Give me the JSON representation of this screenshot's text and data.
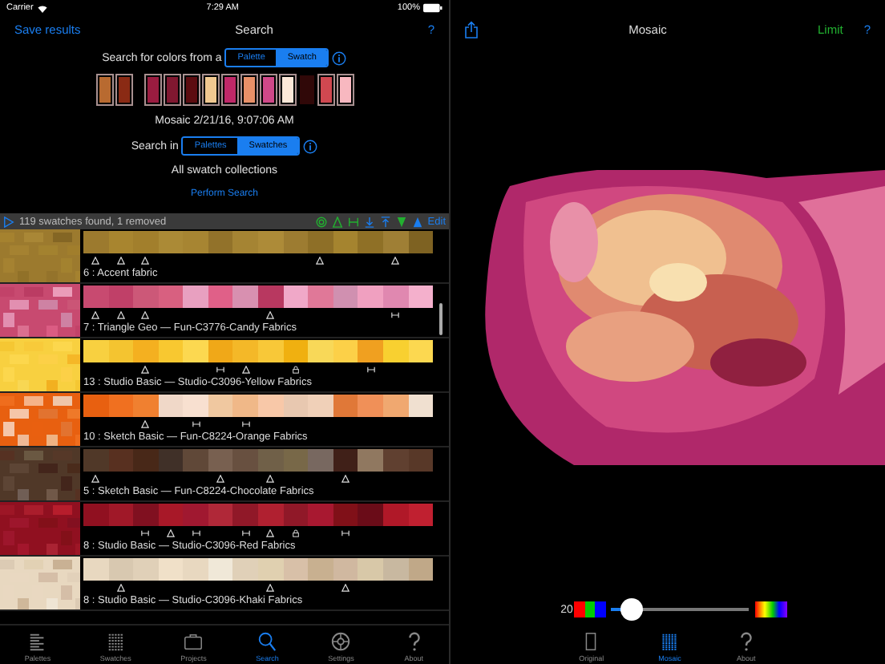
{
  "status_bar": {
    "carrier": "Carrier",
    "time": "7:29 AM",
    "battery": "100%"
  },
  "search_panel": {
    "back": "Save results",
    "title": "Search",
    "help": "?",
    "source_label": "Search for colors from a",
    "source_options": [
      {
        "label": "Palette",
        "selected": false
      },
      {
        "label": "Swatch",
        "selected": true
      }
    ],
    "swatch_groups": [
      {
        "swatches": [
          {
            "color": "#b86a30",
            "outlined": true
          },
          {
            "color": "#8a2a14",
            "outlined": true
          }
        ]
      },
      {
        "swatches": [
          {
            "color": "#9a1c40",
            "outlined": true
          },
          {
            "color": "#801830",
            "outlined": true
          },
          {
            "color": "#5c0c10",
            "outlined": true
          },
          {
            "color": "#f0c890",
            "outlined": true
          },
          {
            "color": "#c02868",
            "outlined": true
          },
          {
            "color": "#e89068",
            "outlined": true
          },
          {
            "color": "#d04888",
            "outlined": true
          },
          {
            "color": "#fde8d8",
            "outlined": true
          },
          {
            "color": "#300808",
            "outlined": false
          },
          {
            "color": "#d04850",
            "outlined": true
          },
          {
            "color": "#f8b8c0",
            "outlined": true
          }
        ]
      }
    ],
    "source_name": "Mosaic 2/21/16, 9:07:06 AM",
    "scope_label": "Search in",
    "scope_options": [
      {
        "label": "Palettes",
        "selected": false
      },
      {
        "label": "Swatches",
        "selected": true
      }
    ],
    "collection": "All swatch collections",
    "action": "Perform Search"
  },
  "results": {
    "summary": "119 swatches found, 1 removed",
    "edit": "Edit",
    "rows": [
      {
        "label": "6 : Accent fabric",
        "cells": [
          {
            "color": "#9c7a2e",
            "kind": "triangle"
          },
          {
            "color": "#a8852f",
            "kind": "triangle"
          },
          {
            "color": "#a27f2c",
            "kind": "triangle"
          },
          {
            "color": "#ab8a36",
            "kind": "plain"
          },
          {
            "color": "#a78532",
            "kind": "plain"
          },
          {
            "color": "#92722a",
            "kind": "plain"
          },
          {
            "color": "#a58433",
            "kind": "plain"
          },
          {
            "color": "#ad8b38",
            "kind": "plain"
          },
          {
            "color": "#9d7c31",
            "kind": "plain"
          },
          {
            "color": "#8e6f27",
            "kind": "triangle"
          },
          {
            "color": "#a5842f",
            "kind": "plain"
          },
          {
            "color": "#8f7026",
            "kind": "plain"
          },
          {
            "color": "#9f7f35",
            "kind": "triangle"
          },
          {
            "color": "#7e6222",
            "kind": "plain"
          }
        ]
      },
      {
        "label": "7 : Triangle Geo — Fun-C3776-Candy Fabrics",
        "cells": [
          {
            "color": "#c84a70",
            "kind": "triangle"
          },
          {
            "color": "#c04068",
            "kind": "triangle"
          },
          {
            "color": "#cc5878",
            "kind": "triangle"
          },
          {
            "color": "#d86080",
            "kind": "plain"
          },
          {
            "color": "#e8a0c0",
            "kind": "plain"
          },
          {
            "color": "#e06088",
            "kind": "plain"
          },
          {
            "color": "#d890b0",
            "kind": "plain"
          },
          {
            "color": "#b83860",
            "kind": "triangle"
          },
          {
            "color": "#f0a8c8",
            "kind": "plain"
          },
          {
            "color": "#e07898",
            "kind": "plain"
          },
          {
            "color": "#d090b0",
            "kind": "plain"
          },
          {
            "color": "#f0a0c0",
            "kind": "plain"
          },
          {
            "color": "#e088b0",
            "kind": "bar"
          },
          {
            "color": "#f4b0cc",
            "kind": "plain"
          }
        ]
      },
      {
        "label": "13 : Studio Basic — Studio-C3096-Yellow Fabrics",
        "cells": [
          {
            "color": "#f8d040",
            "kind": "plain"
          },
          {
            "color": "#f4c430",
            "kind": "plain"
          },
          {
            "color": "#f4b020",
            "kind": "triangle"
          },
          {
            "color": "#f8c830",
            "kind": "plain"
          },
          {
            "color": "#fcd850",
            "kind": "plain"
          },
          {
            "color": "#f0a818",
            "kind": "bar"
          },
          {
            "color": "#f4b828",
            "kind": "triangle"
          },
          {
            "color": "#f8c838",
            "kind": "plain"
          },
          {
            "color": "#f0b010",
            "kind": "lock"
          },
          {
            "color": "#f8d858",
            "kind": "plain"
          },
          {
            "color": "#fcd048",
            "kind": "plain"
          },
          {
            "color": "#f0a020",
            "kind": "bar"
          },
          {
            "color": "#f8d030",
            "kind": "plain"
          },
          {
            "color": "#fcd850",
            "kind": "plain"
          }
        ]
      },
      {
        "label": "10 : Sketch Basic — Fun-C8224-Orange Fabrics",
        "cells": [
          {
            "color": "#e86010",
            "kind": "plain"
          },
          {
            "color": "#f07020",
            "kind": "plain"
          },
          {
            "color": "#f08030",
            "kind": "triangle"
          },
          {
            "color": "#f0d8c8",
            "kind": "plain"
          },
          {
            "color": "#f8e0d0",
            "kind": "bar"
          },
          {
            "color": "#f0c8a0",
            "kind": "plain"
          },
          {
            "color": "#f0b888",
            "kind": "bar"
          },
          {
            "color": "#f8c8a8",
            "kind": "plain"
          },
          {
            "color": "#e8c8b0",
            "kind": "plain"
          },
          {
            "color": "#f0d0b8",
            "kind": "plain"
          },
          {
            "color": "#e07838",
            "kind": "plain"
          },
          {
            "color": "#f09058",
            "kind": "plain"
          },
          {
            "color": "#f0a870",
            "kind": "plain"
          },
          {
            "color": "#f0e0d0",
            "kind": "plain"
          }
        ]
      },
      {
        "label": "5 : Sketch Basic — Fun-C8224-Chocolate Fabrics",
        "cells": [
          {
            "color": "#503828",
            "kind": "triangle"
          },
          {
            "color": "#583020",
            "kind": "plain"
          },
          {
            "color": "#482818",
            "kind": "plain"
          },
          {
            "color": "#403028",
            "kind": "plain"
          },
          {
            "color": "#604838",
            "kind": "plain"
          },
          {
            "color": "#786050",
            "kind": "triangle"
          },
          {
            "color": "#685040",
            "kind": "plain"
          },
          {
            "color": "#706048",
            "kind": "triangle"
          },
          {
            "color": "#786848",
            "kind": "plain"
          },
          {
            "color": "#786860",
            "kind": "plain"
          },
          {
            "color": "#402018",
            "kind": "triangle"
          },
          {
            "color": "#907860",
            "kind": "plain"
          },
          {
            "color": "#604030",
            "kind": "plain"
          },
          {
            "color": "#583828",
            "kind": "plain"
          }
        ]
      },
      {
        "label": "8 : Studio Basic — Studio-C3096-Red Fabrics",
        "cells": [
          {
            "color": "#901020",
            "kind": "plain"
          },
          {
            "color": "#a01828",
            "kind": "plain"
          },
          {
            "color": "#801020",
            "kind": "bar"
          },
          {
            "color": "#a81828",
            "kind": "triangle"
          },
          {
            "color": "#a01830",
            "kind": "bar"
          },
          {
            "color": "#b02838",
            "kind": "plain"
          },
          {
            "color": "#901828",
            "kind": "bar"
          },
          {
            "color": "#b02030",
            "kind": "triangle"
          },
          {
            "color": "#901828",
            "kind": "lock"
          },
          {
            "color": "#a81830",
            "kind": "plain"
          },
          {
            "color": "#801018",
            "kind": "bar"
          },
          {
            "color": "#6a0c18",
            "kind": "plain"
          },
          {
            "color": "#b01828",
            "kind": "plain"
          },
          {
            "color": "#c02030",
            "kind": "plain"
          }
        ]
      },
      {
        "label": "8 : Studio Basic — Studio-C3096-Khaki Fabrics",
        "cells": [
          {
            "color": "#e8d8c0",
            "kind": "plain"
          },
          {
            "color": "#d8c8b0",
            "kind": "triangle"
          },
          {
            "color": "#e0d0b8",
            "kind": "plain"
          },
          {
            "color": "#f0e0c8",
            "kind": "plain"
          },
          {
            "color": "#e8d8c0",
            "kind": "plain"
          },
          {
            "color": "#f0e8d8",
            "kind": "plain"
          },
          {
            "color": "#e0d0b8",
            "kind": "plain"
          },
          {
            "color": "#e0d0b0",
            "kind": "triangle"
          },
          {
            "color": "#d8c0a8",
            "kind": "plain"
          },
          {
            "color": "#c8b090",
            "kind": "plain"
          },
          {
            "color": "#d0b8a0",
            "kind": "triangle"
          },
          {
            "color": "#d8c8a8",
            "kind": "plain"
          },
          {
            "color": "#c8b8a0",
            "kind": "plain"
          },
          {
            "color": "#c0a888",
            "kind": "plain"
          }
        ]
      }
    ]
  },
  "left_tabs": [
    {
      "label": "Palettes",
      "selected": false
    },
    {
      "label": "Swatches",
      "selected": false
    },
    {
      "label": "Projects",
      "selected": false
    },
    {
      "label": "Search",
      "selected": true
    },
    {
      "label": "Settings",
      "selected": false
    },
    {
      "label": "About",
      "selected": false
    }
  ],
  "mosaic_panel": {
    "title": "Mosaic",
    "limit": "Limit",
    "help": "?",
    "slider": {
      "reading": "20",
      "level": 0.15
    }
  },
  "right_tabs": [
    {
      "label": "Original",
      "selected": false
    },
    {
      "label": "Mosaic",
      "selected": true
    },
    {
      "label": "About",
      "selected": false
    }
  ]
}
